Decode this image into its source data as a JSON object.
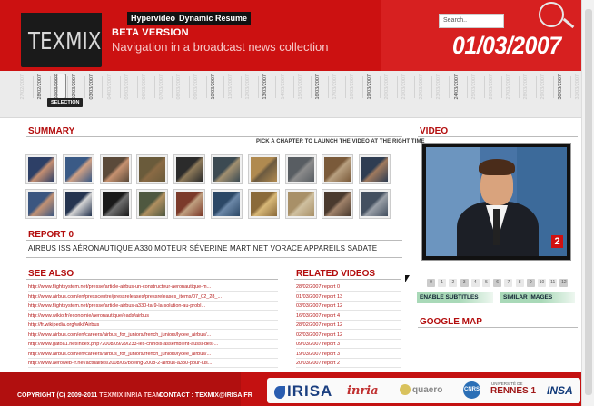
{
  "header": {
    "logo": "TEXMIX",
    "tabs": [
      "Hypervideos",
      "Dynamic Resume"
    ],
    "beta_label": "BETA VERSION",
    "subtitle": "Navigation in a broadcast news collection",
    "current_date": "01/03/2007",
    "search_placeholder": "Search..",
    "colors": {
      "brand_red": "#cc1111",
      "accent_dark": "#111111"
    }
  },
  "timeline": {
    "dates": [
      "27/02/2007",
      "28/02/2007",
      "01/03/2007",
      "02/03/2007",
      "03/03/2007",
      "04/03/2007",
      "05/03/2007",
      "06/03/2007",
      "07/03/2007",
      "08/03/2007",
      "09/03/2007",
      "10/03/2007",
      "11/03/2007",
      "12/03/2007",
      "13/03/2007",
      "14/03/2007",
      "15/03/2007",
      "16/03/2007",
      "17/03/2007",
      "18/03/2007",
      "19/03/2007",
      "20/03/2007",
      "21/03/2007",
      "22/03/2007",
      "23/03/2007",
      "24/03/2007",
      "25/03/2007",
      "26/03/2007",
      "27/03/2007",
      "28/03/2007",
      "29/03/2007",
      "30/03/2007",
      "31/03/2007"
    ],
    "selection_label": "SELECTION"
  },
  "summary": {
    "title": "SUMMARY",
    "hint": "PICK A CHAPTER TO LAUNCH THE VIDEO AT THE RIGHT TIME"
  },
  "report": {
    "title": "REPORT 0",
    "keywords": "AIRBUS ISS AÉRONAUTIQUE A330 MOTEUR SÉVERINE MARTINET VORACE APPAREILS SADATE"
  },
  "see_also": {
    "title": "SEE ALSO",
    "links": [
      "http://www.flightsystem.net/presse/article-airbus-un-constructeur-aeronautique-m...",
      "http://www.airbus.com/en/presscentre/pressreleases/pressreleases_items/07_02_28_...",
      "http://www.flightsystem.net/presse/article-airbus-a330-ta-9-la-solution-au-probl...",
      "http://www.wikio.fr/economie/aeronautique/eads/airbus",
      "http://fr.wikipedia.org/wiki/Airbus",
      "http://www.airbus.com/en/careers/airbus_for_juniors/french_juniors/lycee_airbus/...",
      "http://www.gatoa1.net/index.php?2008/09/29/233-les-chinois-assemblent-aussi-des-...",
      "http://www.airbus.com/en/careers/airbus_for_juniors/french_juniors/lycee_airbus/...",
      "http://www.aeroweb-fr.net/actualites/2008/06/boeing-2008-2-airbus-a330-pour-lus..."
    ]
  },
  "related_videos": {
    "title": "RELATED VIDEOS",
    "items": [
      "28/02/2007 report 0",
      "01/03/2007 report 13",
      "03/03/2007 report 12",
      "16/03/2007 report 4",
      "28/02/2007 report 12",
      "02/03/2007 report 12",
      "09/03/2007 report 3",
      "19/03/2007 report 3",
      "20/03/2007 report 2"
    ]
  },
  "video": {
    "title": "VIDEO",
    "channel_logo": "2",
    "chapter_numbers": [
      "0",
      "1",
      "2",
      "3",
      "4",
      "5",
      "6",
      "7",
      "8",
      "9",
      "10",
      "11",
      "12"
    ],
    "enable_subtitles": "ENABLE SUBTITLES",
    "similar_images": "SIMILAR IMAGES"
  },
  "google_map": {
    "title": "GOOGLE MAP"
  },
  "footer": {
    "copyright": "COPYRIGHT (C) 2009-2011",
    "team": "TEXMIX INRIA TEAM",
    "contact": "CONTACT : TEXMIX@IRISA.FR",
    "partners": {
      "irisa": "IRISA",
      "inria": "inria",
      "quaero": "quaero",
      "cnrs": "CNRS",
      "rennes_small": "UNIVERSITÉ DE",
      "rennes": "RENNES 1",
      "insa": "INSA"
    }
  }
}
